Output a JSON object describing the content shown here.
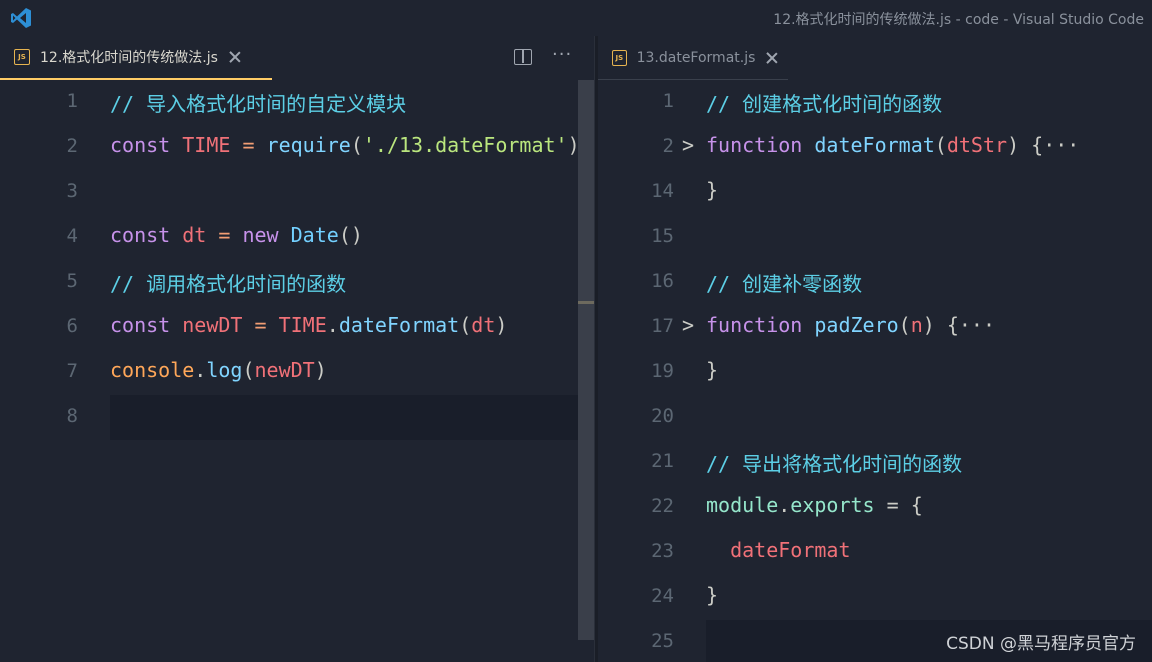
{
  "window": {
    "title": "12.格式化时间的传统做法.js - code - Visual Studio Code"
  },
  "left_pane": {
    "tab": {
      "badge": "JS",
      "label": "12.格式化时间的传统做法.js"
    },
    "more": "···",
    "lines": [
      {
        "num": "1",
        "tokens": [
          {
            "t": "// 导入格式化时间的自定义模块",
            "c": "cmt"
          }
        ]
      },
      {
        "num": "2",
        "tokens": [
          {
            "t": "const ",
            "c": "kw2"
          },
          {
            "t": "TIME",
            "c": "var"
          },
          {
            "t": " = ",
            "c": "op"
          },
          {
            "t": "require",
            "c": "fn"
          },
          {
            "t": "(",
            "c": "punc"
          },
          {
            "t": "'./13.dateFormat'",
            "c": "str"
          },
          {
            "t": ")",
            "c": "punc"
          }
        ]
      },
      {
        "num": "3",
        "tokens": []
      },
      {
        "num": "4",
        "tokens": [
          {
            "t": "const ",
            "c": "kw2"
          },
          {
            "t": "dt",
            "c": "var"
          },
          {
            "t": " = ",
            "c": "op"
          },
          {
            "t": "new ",
            "c": "kw2"
          },
          {
            "t": "Date",
            "c": "cls"
          },
          {
            "t": "()",
            "c": "punc"
          }
        ]
      },
      {
        "num": "5",
        "tokens": [
          {
            "t": "// 调用格式化时间的函数",
            "c": "cmt"
          }
        ]
      },
      {
        "num": "6",
        "tokens": [
          {
            "t": "const ",
            "c": "kw2"
          },
          {
            "t": "newDT",
            "c": "var"
          },
          {
            "t": " = ",
            "c": "op"
          },
          {
            "t": "TIME",
            "c": "var"
          },
          {
            "t": ".",
            "c": "punc"
          },
          {
            "t": "dateFormat",
            "c": "fn"
          },
          {
            "t": "(",
            "c": "punc"
          },
          {
            "t": "dt",
            "c": "var"
          },
          {
            "t": ")",
            "c": "punc"
          }
        ]
      },
      {
        "num": "7",
        "tokens": [
          {
            "t": "console",
            "c": "kw"
          },
          {
            "t": ".",
            "c": "punc"
          },
          {
            "t": "log",
            "c": "fn"
          },
          {
            "t": "(",
            "c": "punc"
          },
          {
            "t": "newDT",
            "c": "var"
          },
          {
            "t": ")",
            "c": "punc"
          }
        ]
      },
      {
        "num": "8",
        "tokens": [],
        "current": true
      }
    ]
  },
  "right_pane": {
    "tab": {
      "badge": "JS",
      "label": "13.dateFormat.js"
    },
    "lines": [
      {
        "num": "1",
        "tokens": [
          {
            "t": "// 创建格式化时间的函数",
            "c": "cmt"
          }
        ]
      },
      {
        "num": "2",
        "fold": ">",
        "tokens": [
          {
            "t": "function ",
            "c": "kw2"
          },
          {
            "t": "dateFormat",
            "c": "fn"
          },
          {
            "t": "(",
            "c": "punc"
          },
          {
            "t": "dtStr",
            "c": "var"
          },
          {
            "t": ") {",
            "c": "punc"
          },
          {
            "t": "···",
            "c": "punc"
          }
        ]
      },
      {
        "num": "14",
        "tokens": [
          {
            "t": "}",
            "c": "punc"
          }
        ]
      },
      {
        "num": "15",
        "tokens": []
      },
      {
        "num": "16",
        "tokens": [
          {
            "t": "// 创建补零函数",
            "c": "cmt"
          }
        ]
      },
      {
        "num": "17",
        "fold": ">",
        "tokens": [
          {
            "t": "function ",
            "c": "kw2"
          },
          {
            "t": "padZero",
            "c": "fn"
          },
          {
            "t": "(",
            "c": "punc"
          },
          {
            "t": "n",
            "c": "var"
          },
          {
            "t": ") {",
            "c": "punc"
          },
          {
            "t": "···",
            "c": "punc"
          }
        ]
      },
      {
        "num": "19",
        "tokens": [
          {
            "t": "}",
            "c": "punc"
          }
        ]
      },
      {
        "num": "20",
        "tokens": []
      },
      {
        "num": "21",
        "tokens": [
          {
            "t": "// 导出将格式化时间的函数",
            "c": "cmt"
          }
        ]
      },
      {
        "num": "22",
        "tokens": [
          {
            "t": "module",
            "c": "prop"
          },
          {
            "t": ".",
            "c": "punc"
          },
          {
            "t": "exports",
            "c": "prop"
          },
          {
            "t": " = {",
            "c": "punc"
          }
        ]
      },
      {
        "num": "23",
        "tokens": [
          {
            "t": "  dateFormat",
            "c": "var"
          }
        ]
      },
      {
        "num": "24",
        "tokens": [
          {
            "t": "}",
            "c": "punc"
          }
        ]
      },
      {
        "num": "25",
        "tokens": [],
        "current": true
      }
    ]
  },
  "watermark": "CSDN @黑马程序员官方",
  "colors": {
    "background": "#1f2430",
    "comment": "#5ccfe6",
    "keyword": "#c792ea",
    "variable": "#f07178",
    "function": "#80d4ff",
    "string": "#bae67e",
    "tab_accent": "#ffcc66"
  }
}
